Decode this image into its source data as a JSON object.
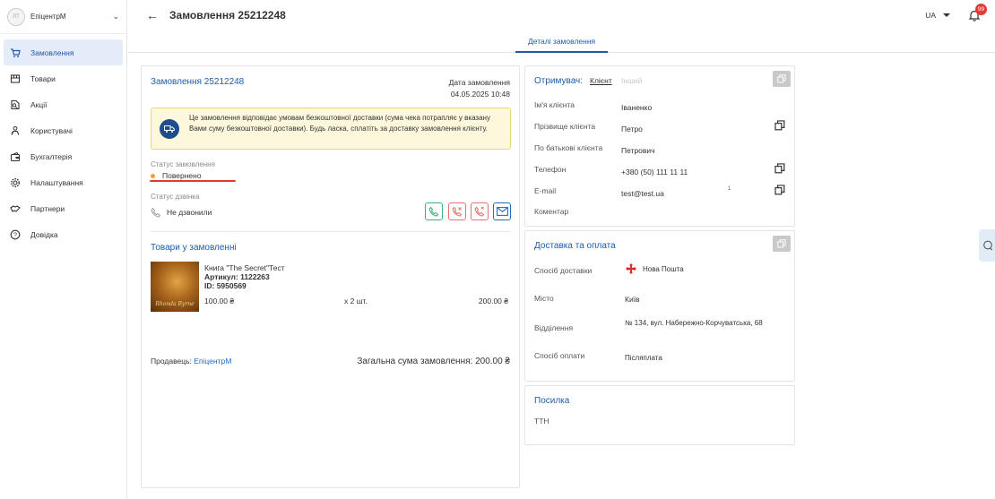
{
  "sidebar": {
    "logo_text": "ЛТ",
    "shop_name": "ЕпіцентрМ",
    "items": [
      {
        "label": "Замовлення",
        "icon": "cart-icon",
        "active": true
      },
      {
        "label": "Товари",
        "icon": "box-icon"
      },
      {
        "label": "Акції",
        "icon": "discount-icon"
      },
      {
        "label": "Користувачі",
        "icon": "users-icon"
      },
      {
        "label": "Бухгалтерія",
        "icon": "wallet-icon"
      },
      {
        "label": "Налаштування",
        "icon": "gear-icon"
      },
      {
        "label": "Партнери",
        "icon": "handshake-icon"
      },
      {
        "label": "Довідка",
        "icon": "help-icon"
      }
    ]
  },
  "header": {
    "title": "Замовлення 25212248",
    "lang": "UA",
    "notifications": "99"
  },
  "tabs": [
    "Деталі замовлення"
  ],
  "order": {
    "title": "Замовлення 25212248",
    "date_label": "Дата замовлення",
    "date_value": "04.05.2025 10:48",
    "notice": "Це замовлення відповідає умовам безкоштовної доставки (сума чека потрапляє у вказану Вами суму безкоштовної доставки). Будь ласка, сплатіть за доставку замовлення клієнту.",
    "status_label": "Статус замовлення",
    "status_value": "Повернено",
    "call_status_label": "Статус дзвінка",
    "call_status_value": "Не дзвонили",
    "products_title": "Товари у замовленні",
    "product": {
      "name": "Книга \"The Secret\"Тест",
      "article": "Артикул: 1122263",
      "id": "ID: 5950569",
      "price": "100.00 ₴",
      "qty": "x 2 шт.",
      "sum": "200.00 ₴",
      "cover_text": "Rhonda Byrne"
    },
    "seller_label": "Продавець:",
    "seller_name": "ЕпіцентрМ",
    "total": "Загальна сума замовлення: 200.00 ₴"
  },
  "recipient": {
    "label": "Отримувач:",
    "tab_client": "Клієнт",
    "tab_other": "Інший",
    "rows": [
      {
        "label": "Ім'я клієнта",
        "value": "Іваненко"
      },
      {
        "label": "Прізвище клієнта",
        "value": "Петро"
      },
      {
        "label": "По батькові клієнта",
        "value": "Петрович"
      },
      {
        "label": "Телефон",
        "value": "+380 (50) 111 11 11"
      },
      {
        "label": "E-mail",
        "value": "test@test.ua",
        "extra": "1"
      },
      {
        "label": "Коментар",
        "value": ""
      }
    ]
  },
  "delivery": {
    "title": "Доставка та оплата",
    "rows": [
      {
        "label": "Спосіб доставки",
        "value": "Нова Пошта"
      },
      {
        "label": "Місто",
        "value": "Київ"
      },
      {
        "label": "Відділення",
        "value": "№ 134, вул. Набережно-Корчуватська, 68"
      },
      {
        "label": "Спосіб оплати",
        "value": "Післяплата"
      }
    ]
  },
  "parcel": {
    "title": "Посилка",
    "ttn_label": "ТТН"
  },
  "colors": {
    "accent": "#1e5aa8",
    "status_dot": "#f0a030",
    "notice_bg": "#fdf8dc",
    "badge": "#e53935"
  }
}
